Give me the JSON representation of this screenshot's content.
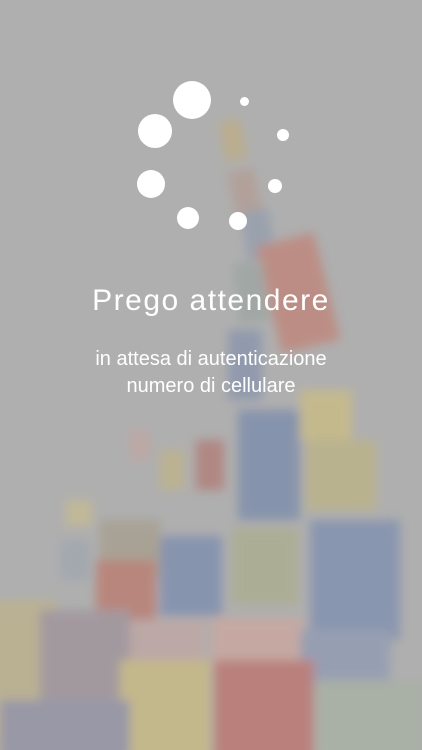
{
  "loading": {
    "spinner_icon": "loading-spinner-icon",
    "title": "Prego attendere",
    "message_line1": "in attesa di autenticazione",
    "message_line2": "numero di cellulare"
  },
  "colors": {
    "text": "#ffffff",
    "spinner": "#ffffff",
    "background": "#b3b3b3"
  }
}
